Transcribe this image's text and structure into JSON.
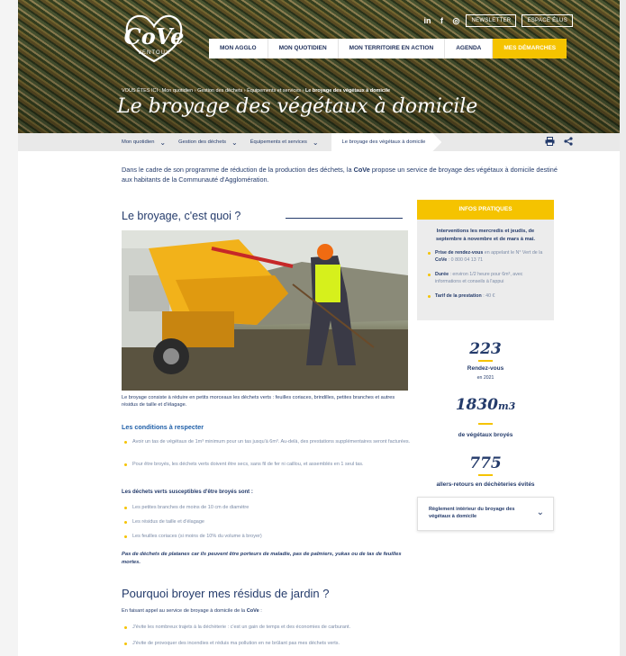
{
  "header": {
    "logo": {
      "name": "CoVe",
      "sub": "VENTOUX"
    },
    "social": [
      "in",
      "f",
      "◎"
    ],
    "buttons": {
      "newsletter": "NEWSLETTER",
      "espace_elus": "ESPACE ÉLUS"
    },
    "nav": [
      "MON AGGLO",
      "MON QUOTIDIEN",
      "MON TERRITOIRE EN ACTION",
      "AGENDA",
      "MES DÉMARCHES"
    ],
    "breadcrumb": {
      "prefix": "VOUS ÊTES ICI :",
      "items": [
        "Mon quotidien",
        "Gestion des déchets",
        "Équipements et services"
      ],
      "current": "Le broyage des végétaux à domicile"
    },
    "title": "Le broyage des végétaux à domicile"
  },
  "subnav": {
    "items": [
      "Mon quotidien",
      "Gestion des déchets",
      "Équipements et services"
    ],
    "current": "Le broyage des végétaux à domicile",
    "icons": [
      "print-icon",
      "share-icon"
    ]
  },
  "intro": {
    "before": "Dans le cadre de son programme de réduction de la production des déchets, la ",
    "brand": "CoVe",
    "after": " propose un service de broyage des végétaux à domicile destiné aux habitants de la Communauté d'Agglomération."
  },
  "section1": {
    "title": "Le broyage, c'est quoi ?",
    "caption": "Le broyage consiste à réduire en petits morceaux les déchets verts : feuilles coriaces, brindilles, petites branches et autres résidus de taille et d'élagage.",
    "conditions_title": "Les conditions à respecter",
    "conditions": [
      "Avoir un tas de végétaux de 1m³ minimum pour un tas jusqu'à 6m³. Au-delà, des prestations supplémentaires seront facturées.",
      "Pour être broyés, les déchets verts doivent être secs, sans fil de fer ni caillou, et assemblés en 1 seul tas."
    ],
    "broyes_title": "Les déchets verts susceptibles d'être broyés sont :",
    "broyes": [
      "Les petites branches de moins de 10 cm de diamètre",
      "Les résidus de taille et d'élagage",
      "Les feuilles coriaces (si moins de 10% du volume à broyer)"
    ],
    "note": "Pas de déchets de platanes car ils peuvent être porteurs de maladie, pas de palmiers, yukas ou de tas de feuilles mortes."
  },
  "section2": {
    "title": "Pourquoi broyer mes résidus de jardin ?",
    "lead_before": "En faisant appel au service de broyage à domicile de la ",
    "lead_brand": "CoVe",
    "lead_after": " :",
    "items": [
      "J'évite les nombreux trajets à la déchèterie : c'est un gain de temps et des économies de carburant.",
      "J'évite de provoquer des incendies et réduis ma pollution en ne brûlant pas mes déchets verts."
    ]
  },
  "sidebar": {
    "infos_title": "INFOS PRATIQUES",
    "infos_lead": "Interventions les mercredis et jeudis, de septembre à novembre et de mars à mai.",
    "infos_items": [
      {
        "label": "Prise de rendez-vous",
        "text_before": " en appelant le N° Vert de la ",
        "brand": "CoVe",
        "text_after": " : 0 800 04 13 71"
      },
      {
        "label": "Durée",
        "text_before": " : environ 1/2 heure pour 6m³, avec informations et conseils à l'appui",
        "brand": "",
        "text_after": ""
      },
      {
        "label": "Tarif de la prestation",
        "text_before": " : 40 €",
        "brand": "",
        "text_after": ""
      }
    ],
    "stats": [
      {
        "value": "223",
        "label": "Rendez-vous",
        "sub": "en 2021"
      },
      {
        "value": "1830",
        "unit": "m3",
        "label": "de végétaux broyés",
        "sub": ""
      },
      {
        "value": "775",
        "label": "allers-retours en déchèteries évités",
        "sub": ""
      }
    ],
    "reglement": "Règlement intérieur du broyage des végétaux à domicile"
  },
  "colors": {
    "accent": "#f5c300",
    "text": "#243b6b",
    "muted": "#7a8aa6",
    "subnav_bg": "#e9e9e9",
    "panel_bg": "#ececec"
  }
}
